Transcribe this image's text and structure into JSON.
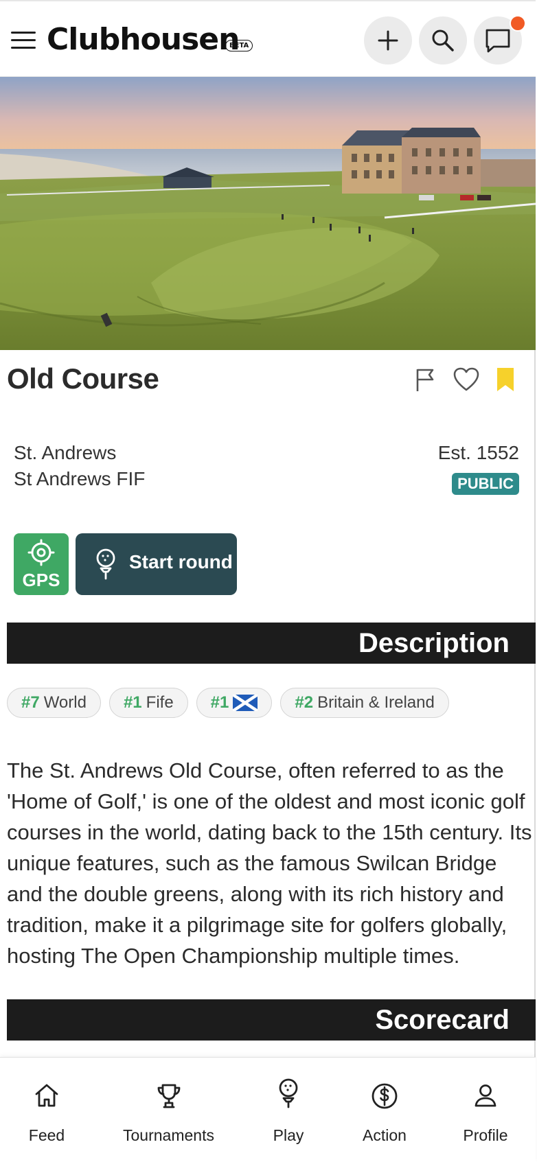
{
  "header": {
    "app_name": "Clubhousen",
    "beta_label": "BETA"
  },
  "course": {
    "name": "Old Course",
    "city": "St. Andrews",
    "region": "St Andrews FIF",
    "established": "Est. 1552",
    "access": "PUBLIC"
  },
  "actions": {
    "gps_label": "GPS",
    "start_round_label": "Start round"
  },
  "sections": {
    "description_title": "Description",
    "scorecard_title": "Scorecard"
  },
  "rankings": [
    {
      "rank": "#7",
      "label": "World"
    },
    {
      "rank": "#1",
      "label": "Fife"
    },
    {
      "rank": "#1",
      "label": ""
    },
    {
      "rank": "#2",
      "label": "Britain & Ireland"
    }
  ],
  "description": "The St. Andrews Old Course, often referred to as the 'Home of Golf,' is one of the oldest and most iconic golf courses in the world, dating back to the 15th century. Its unique features, such as the famous Swilcan Bridge and the double greens, along with its rich history and tradition, make it a pilgrimage site for golfers globally, hosting The Open Championship multiple times.",
  "bottom_nav": [
    {
      "label": "Feed",
      "icon": "home-icon"
    },
    {
      "label": "Tournaments",
      "icon": "trophy-icon"
    },
    {
      "label": "Play",
      "icon": "golf-ball-tee-icon"
    },
    {
      "label": "Action",
      "icon": "dollar-circle-icon"
    },
    {
      "label": "Profile",
      "icon": "user-icon"
    }
  ],
  "colors": {
    "accent_green": "#3fa864",
    "dark_teal": "#2b4a52",
    "public_badge": "#2e8b8b",
    "bookmark_yellow": "#f6d12b",
    "notification": "#f15a24",
    "section_bar": "#1c1c1c"
  }
}
